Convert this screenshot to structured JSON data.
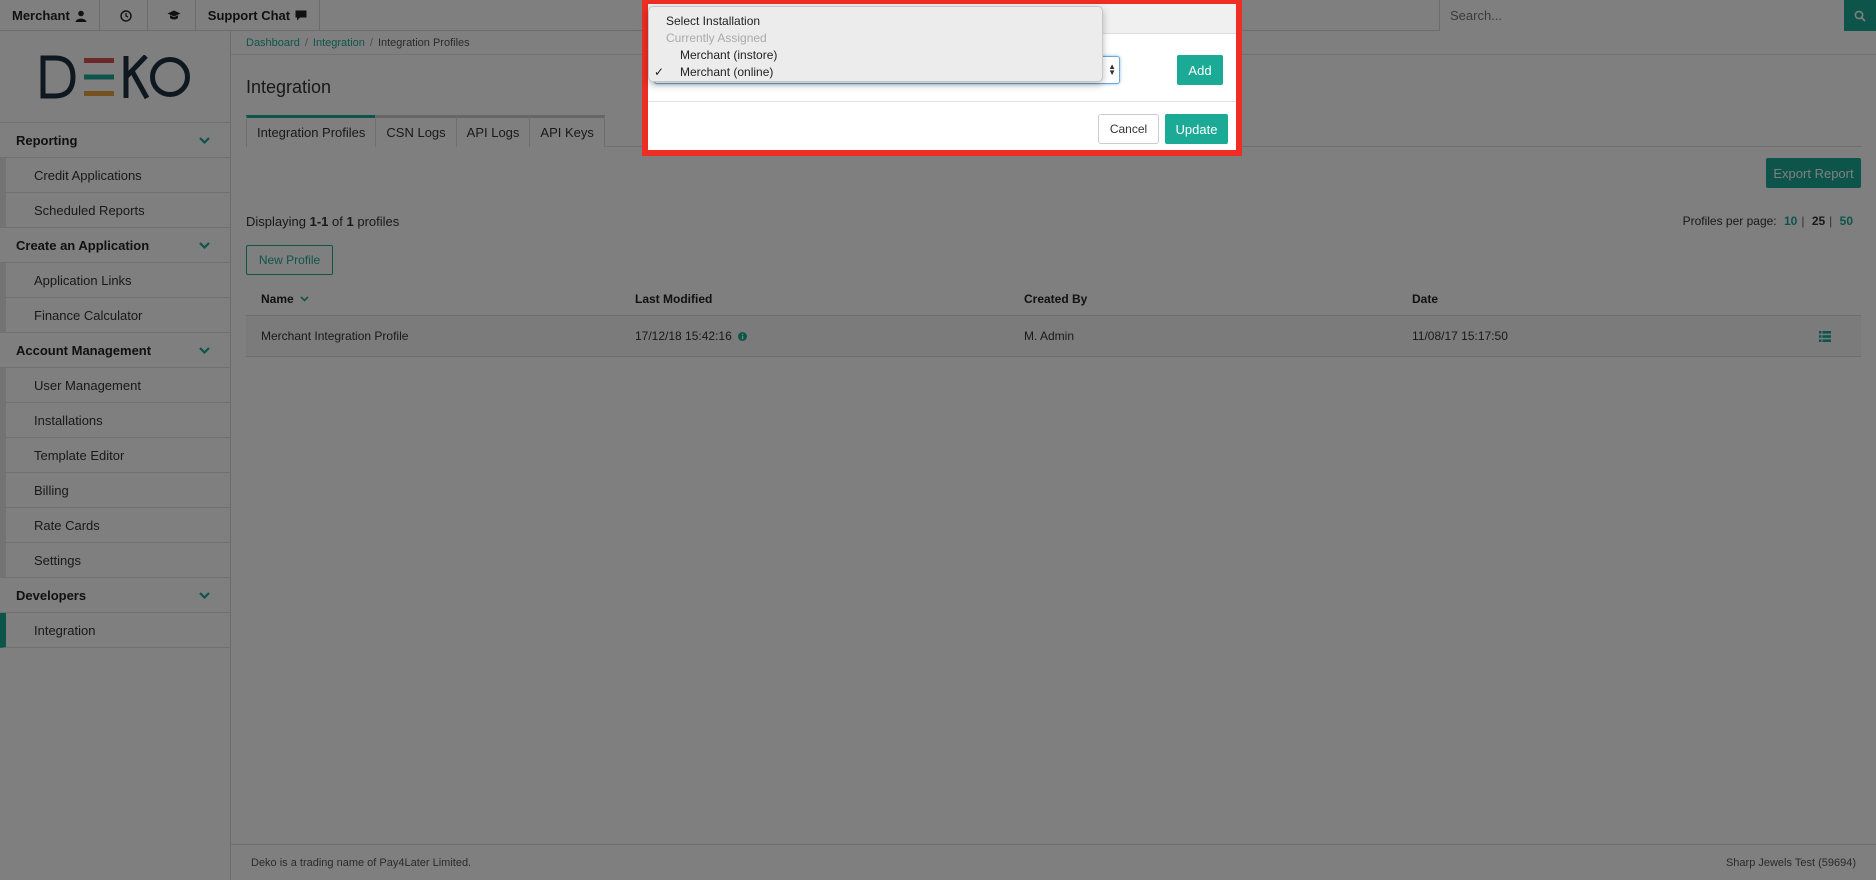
{
  "topbar": {
    "merchant_label": "Merchant",
    "support_label": "Support Chat",
    "search_placeholder": "Search..."
  },
  "sidebar": {
    "logo_text": "DEKO",
    "sections": [
      {
        "label": "Reporting",
        "items": [
          "Credit Applications",
          "Scheduled Reports"
        ]
      },
      {
        "label": "Create an Application",
        "items": [
          "Application Links",
          "Finance Calculator"
        ]
      },
      {
        "label": "Account Management",
        "items": [
          "User Management",
          "Installations",
          "Template Editor",
          "Billing",
          "Rate Cards",
          "Settings"
        ]
      },
      {
        "label": "Developers",
        "items": [
          "Integration"
        ]
      }
    ],
    "active_item": "Integration"
  },
  "breadcrumb": {
    "items": [
      "Dashboard",
      "Integration",
      "Integration Profiles"
    ],
    "separator": "/"
  },
  "page": {
    "title": "Integration",
    "tabs": [
      "Integration Profiles",
      "CSN Logs",
      "API Logs",
      "API Keys"
    ],
    "active_tab": "Integration Profiles",
    "export_label": "Export Report",
    "displaying": {
      "prefix": "Displaying",
      "range": "1-1",
      "of": "of",
      "total": "1",
      "suffix": "profiles"
    },
    "per_page": {
      "label": "Profiles per page:",
      "options": [
        "10",
        "25",
        "50"
      ],
      "selected": "25"
    },
    "new_profile_label": "New Profile"
  },
  "table": {
    "columns": [
      "Name",
      "Last Modified",
      "Created By",
      "Date"
    ],
    "rows": [
      {
        "name": "Merchant Integration Profile",
        "last_modified": "17/12/18 15:42:16",
        "created_by": "M. Admin",
        "date": "11/08/17 15:17:50"
      }
    ]
  },
  "footer": {
    "left": "Deko is a trading name of Pay4Later Limited.",
    "right": "Sharp Jewels Test (59694)"
  },
  "modal": {
    "add_label": "Add",
    "cancel_label": "Cancel",
    "update_label": "Update",
    "dropdown": {
      "placeholder": "Select Installation",
      "group_label": "Currently Assigned",
      "options": [
        "Merchant (instore)",
        "Merchant (online)"
      ],
      "selected": "Merchant (online)"
    }
  },
  "colors": {
    "accent": "#1aaa96",
    "highlight_border": "#ee2e24"
  }
}
